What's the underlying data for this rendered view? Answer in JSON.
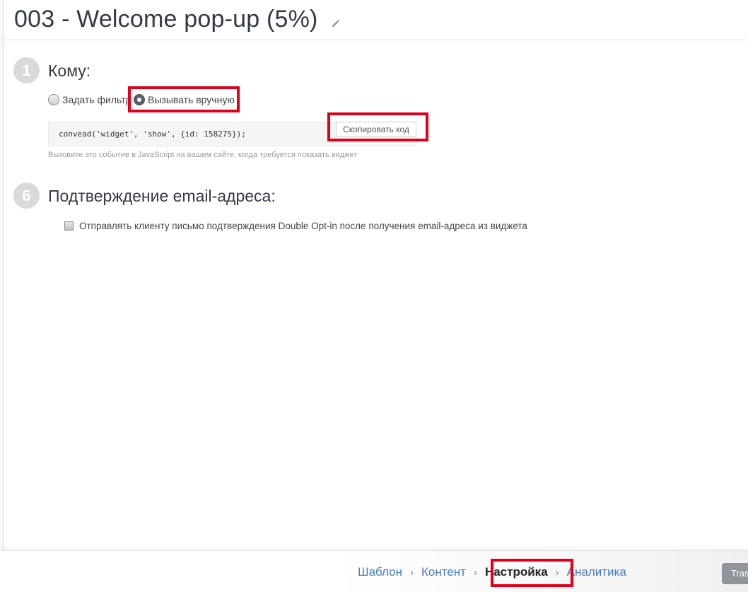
{
  "header": {
    "title": "003 - Welcome pop-up (5%)",
    "edit_icon": "pencil-icon"
  },
  "sections": [
    {
      "number": "1",
      "title": "Кому:",
      "radio_options": [
        {
          "label": "Задать фильтр",
          "checked": false
        },
        {
          "label": "Вызывать вручную",
          "checked": true
        }
      ],
      "code": "convead('widget', 'show', {id: 158275});",
      "copy_button": "Скопировать код",
      "hint": "Вызовите это событие в JavaScript на вашем сайте, когда требуется показать виджет"
    },
    {
      "number": "6",
      "title": "Подтверждение email-адреса:",
      "checkbox": {
        "label": "Отправлять клиенту письмо подтверждения Double Opt-in после получения email-адреса из виджета",
        "checked": false
      }
    }
  ],
  "footer": {
    "steps": [
      {
        "label": "Шаблон",
        "active": false
      },
      {
        "label": "Контент",
        "active": false
      },
      {
        "label": "Настройка",
        "active": true
      },
      {
        "label": "Аналитика",
        "active": false
      }
    ],
    "separator": "›",
    "trash_button": "Tras"
  },
  "colors": {
    "highlight": "#e1001a",
    "link": "#4a7db8",
    "step_circle": "#d9d9d9"
  }
}
